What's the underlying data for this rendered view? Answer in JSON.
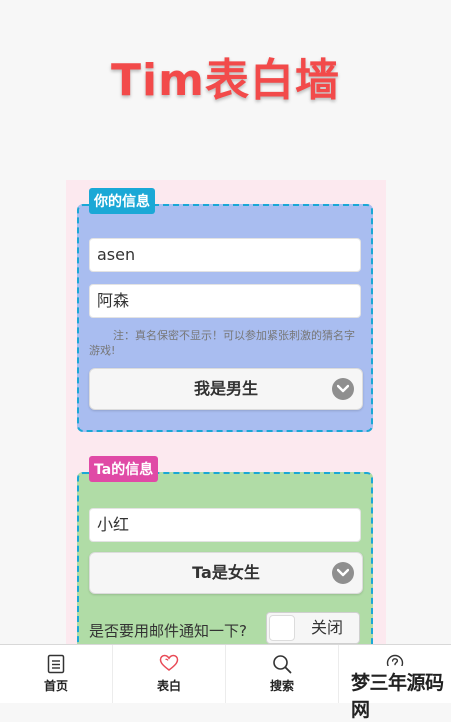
{
  "header": {
    "title": "Tim表白墙"
  },
  "my_info": {
    "badge": "你的信息",
    "name_value": "asen",
    "realname_value": "阿森",
    "note": "注：真名保密不显示！可以参加紧张刺激的猜名字游戏!",
    "gender_select": "我是男生"
  },
  "ta_info": {
    "badge": "Ta的信息",
    "name_value": "小红",
    "gender_select": "Ta是女生",
    "notify_label": "是否要用邮件通知一下?",
    "notify_toggle": "关闭"
  },
  "tabbar": {
    "items": [
      {
        "label": "首页",
        "icon": "document-icon"
      },
      {
        "label": "表白",
        "icon": "heart-icon"
      },
      {
        "label": "搜索",
        "icon": "search-icon"
      },
      {
        "label": "",
        "icon": "help-icon"
      }
    ]
  },
  "watermark": {
    "text": "梦三年源码网"
  },
  "colors": {
    "title": "#f24a4a",
    "my_card": "#a9bdf0",
    "ta_card": "#b0dca6",
    "my_badge": "#1ba8d6",
    "ta_badge": "#e04aa6",
    "active_tab_icon": "#e94b57"
  }
}
